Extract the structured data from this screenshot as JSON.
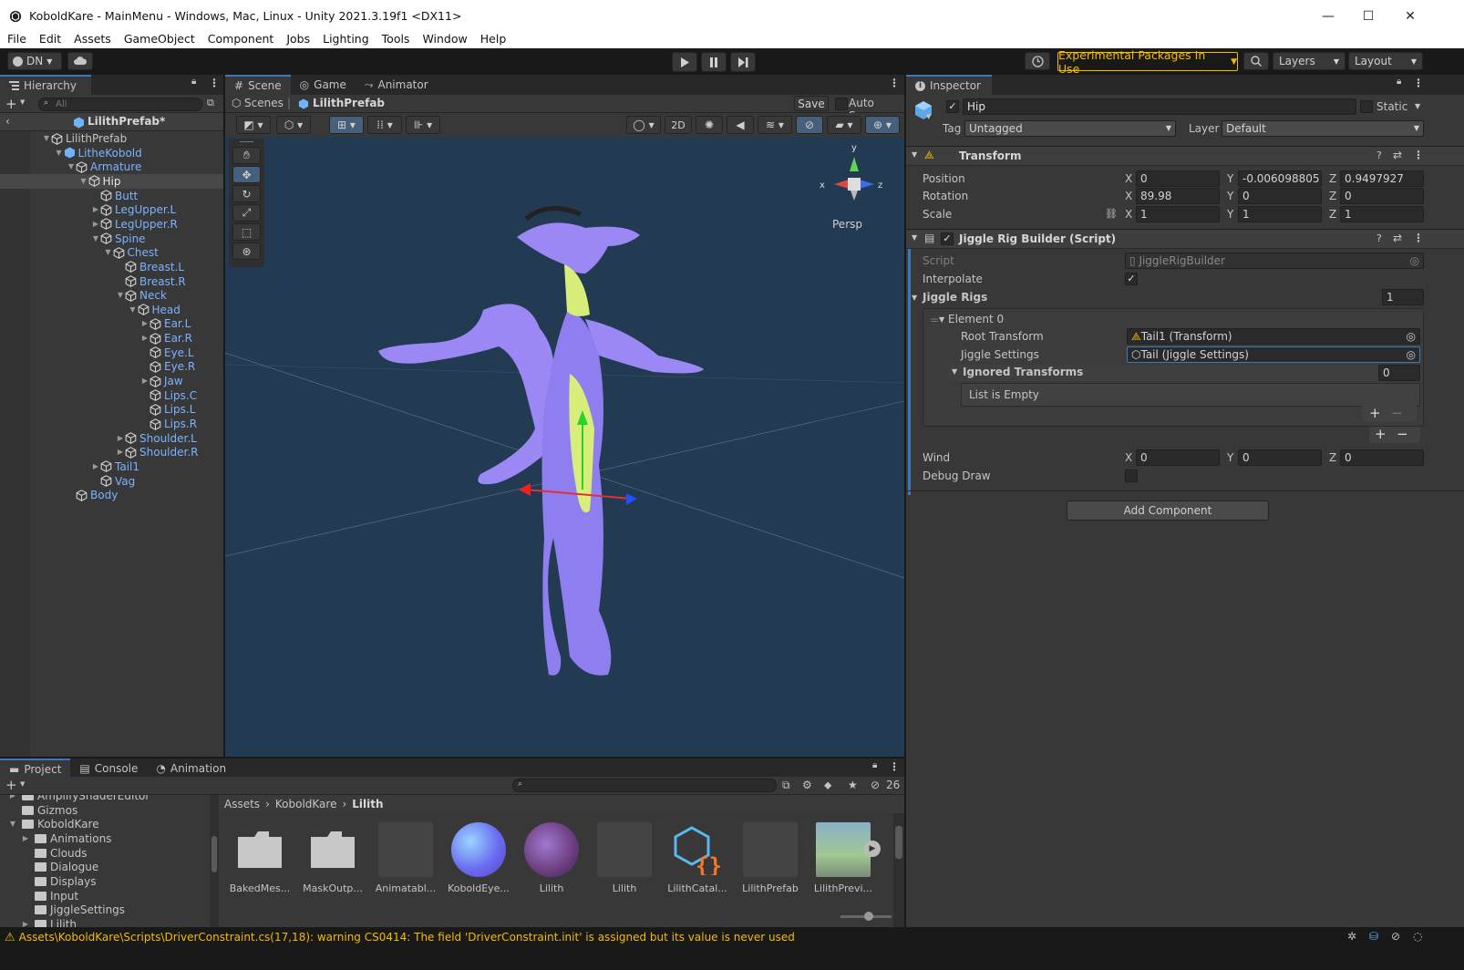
{
  "window": {
    "title": "KoboldKare - MainMenu - Windows, Mac, Linux - Unity 2021.3.19f1 <DX11>",
    "min_glyph": "—",
    "max_glyph": "☐",
    "close_glyph": "✕"
  },
  "menu": [
    "File",
    "Edit",
    "Assets",
    "GameObject",
    "Component",
    "Jobs",
    "Lighting",
    "Tools",
    "Window",
    "Help"
  ],
  "toolbar": {
    "account": "DN",
    "experimental": "Experimental Packages In Use",
    "layers": "Layers",
    "layout": "Layout"
  },
  "hierarchy": {
    "tab": "Hierarchy",
    "search_placeholder": "All",
    "prefab_title": "LilithPrefab*",
    "items": [
      {
        "label": "LilithPrefab",
        "depth": 0,
        "arrow": "▼",
        "blue": false
      },
      {
        "label": "LitheKobold",
        "depth": 1,
        "arrow": "▼",
        "blue": true
      },
      {
        "label": "Armature",
        "depth": 2,
        "arrow": "▼",
        "blue": true
      },
      {
        "label": "Hip",
        "depth": 3,
        "arrow": "▼",
        "blue": false,
        "selected": true
      },
      {
        "label": "Butt",
        "depth": 4,
        "arrow": "",
        "blue": true
      },
      {
        "label": "LegUpper.L",
        "depth": 4,
        "arrow": "▶",
        "blue": true
      },
      {
        "label": "LegUpper.R",
        "depth": 4,
        "arrow": "▶",
        "blue": true
      },
      {
        "label": "Spine",
        "depth": 4,
        "arrow": "▼",
        "blue": true
      },
      {
        "label": "Chest",
        "depth": 5,
        "arrow": "▼",
        "blue": true
      },
      {
        "label": "Breast.L",
        "depth": 6,
        "arrow": "",
        "blue": true
      },
      {
        "label": "Breast.R",
        "depth": 6,
        "arrow": "",
        "blue": true
      },
      {
        "label": "Neck",
        "depth": 6,
        "arrow": "▼",
        "blue": true
      },
      {
        "label": "Head",
        "depth": 7,
        "arrow": "▼",
        "blue": true
      },
      {
        "label": "Ear.L",
        "depth": 8,
        "arrow": "▶",
        "blue": true
      },
      {
        "label": "Ear.R",
        "depth": 8,
        "arrow": "▶",
        "blue": true
      },
      {
        "label": "Eye.L",
        "depth": 8,
        "arrow": "",
        "blue": true
      },
      {
        "label": "Eye.R",
        "depth": 8,
        "arrow": "",
        "blue": true
      },
      {
        "label": "Jaw",
        "depth": 8,
        "arrow": "▶",
        "blue": true
      },
      {
        "label": "Lips.C",
        "depth": 8,
        "arrow": "",
        "blue": true
      },
      {
        "label": "Lips.L",
        "depth": 8,
        "arrow": "",
        "blue": true
      },
      {
        "label": "Lips.R",
        "depth": 8,
        "arrow": "",
        "blue": true
      },
      {
        "label": "Shoulder.L",
        "depth": 6,
        "arrow": "▶",
        "blue": true
      },
      {
        "label": "Shoulder.R",
        "depth": 6,
        "arrow": "▶",
        "blue": true
      },
      {
        "label": "Tail1",
        "depth": 4,
        "arrow": "▶",
        "blue": true
      },
      {
        "label": "Vag",
        "depth": 4,
        "arrow": "",
        "blue": true
      },
      {
        "label": "Body",
        "depth": 2,
        "arrow": "",
        "blue": true
      }
    ]
  },
  "scene": {
    "tabs": [
      "Scene",
      "Game",
      "Animator"
    ],
    "breadcrumb_root": "Scenes",
    "breadcrumb_prefab": "LilithPrefab",
    "save": "Save",
    "auto_save": "Auto Save",
    "mode_2d": "2D",
    "persp": "Persp",
    "axis_x": "x",
    "axis_y": "y",
    "axis_z": "z"
  },
  "inspector": {
    "tab": "Inspector",
    "object_name": "Hip",
    "static": "Static",
    "tag_label": "Tag",
    "tag_value": "Untagged",
    "layer_label": "Layer",
    "layer_value": "Default",
    "transform": {
      "title": "Transform",
      "position_label": "Position",
      "rotation_label": "Rotation",
      "scale_label": "Scale",
      "position": {
        "x": "0",
        "y": "-0.006098805",
        "z": "0.9497927"
      },
      "rotation": {
        "x": "89.98",
        "y": "0",
        "z": "0"
      },
      "scale": {
        "x": "1",
        "y": "1",
        "z": "1"
      }
    },
    "jiggle": {
      "title": "Jiggle Rig Builder (Script)",
      "script_label": "Script",
      "script_value": "JiggleRigBuilder",
      "interpolate_label": "Interpolate",
      "rigs_label": "Jiggle Rigs",
      "rigs_count": "1",
      "element_label": "Element 0",
      "root_label": "Root Transform",
      "root_value": "Tail1 (Transform)",
      "settings_label": "Jiggle Settings",
      "settings_value": "Tail (Jiggle Settings)",
      "ignored_label": "Ignored Transforms",
      "ignored_count": "0",
      "list_empty": "List is Empty",
      "wind_label": "Wind",
      "wind": {
        "x": "0",
        "y": "0",
        "z": "0"
      },
      "debug_label": "Debug Draw"
    },
    "add_component": "Add Component"
  },
  "project": {
    "tabs": [
      "Project",
      "Console",
      "Animation"
    ],
    "hidden_count": "26",
    "folders": [
      {
        "label": "AmplifyShaderEditor",
        "depth": 1,
        "arrow": "▶"
      },
      {
        "label": "Gizmos",
        "depth": 1,
        "arrow": ""
      },
      {
        "label": "KoboldKare",
        "depth": 1,
        "arrow": "▼"
      },
      {
        "label": "Animations",
        "depth": 2,
        "arrow": "▶"
      },
      {
        "label": "Clouds",
        "depth": 2,
        "arrow": ""
      },
      {
        "label": "Dialogue",
        "depth": 2,
        "arrow": ""
      },
      {
        "label": "Displays",
        "depth": 2,
        "arrow": ""
      },
      {
        "label": "Input",
        "depth": 2,
        "arrow": ""
      },
      {
        "label": "JiggleSettings",
        "depth": 2,
        "arrow": ""
      },
      {
        "label": "Lilith",
        "depth": 2,
        "arrow": "▶"
      }
    ],
    "path": [
      "Assets",
      "KoboldKare",
      "Lilith"
    ],
    "assets": [
      "BakedMes...",
      "MaskOutp...",
      "Animatabl...",
      "KoboldEye...",
      "Lilith",
      "Lilith",
      "LilithCatal...",
      "LilithPrefab",
      "LilithPrevi..."
    ]
  },
  "status": {
    "message": "Assets\\KoboldKare\\Scripts\\DriverConstraint.cs(17,18): warning CS0414: The field 'DriverConstraint.init' is assigned but its value is never used"
  },
  "colors": {
    "accent": "#3a79bb",
    "warning": "#f4bc02",
    "link_blue": "#7bb3ff",
    "scene_bg": "#223a52"
  }
}
